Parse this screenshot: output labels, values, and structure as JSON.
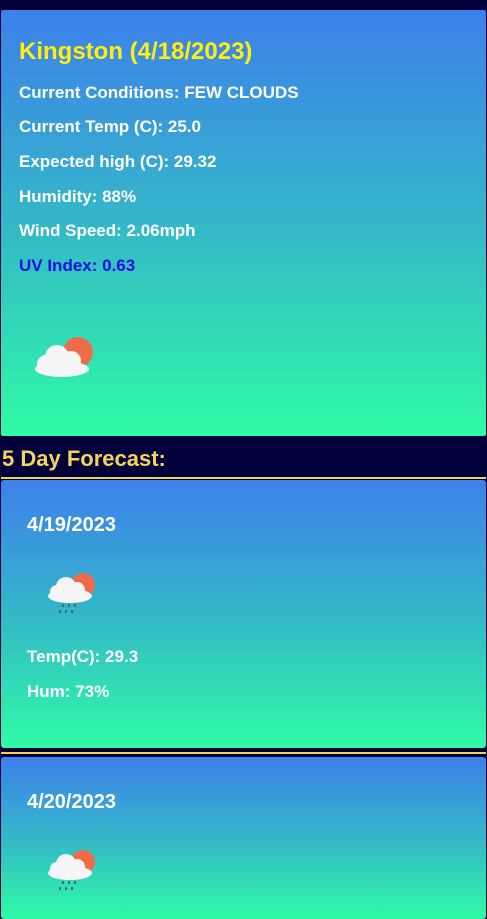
{
  "current": {
    "title": "Kingston (4/18/2023)",
    "conditions": "Current Conditions: FEW CLOUDS",
    "temp": "Current Temp (C): 25.0",
    "high": "Expected high (C): 29.32",
    "humidity": "Humidity: 88%",
    "wind": "Wind Speed: 2.06mph",
    "uv": "UV Index: 0.63",
    "icon": "few-clouds-icon"
  },
  "forecast": {
    "heading": "5 Day Forecast:",
    "days": [
      {
        "date": "4/19/2023",
        "icon": "rain-cloud-sun-icon",
        "temp": "Temp(C): 29.3",
        "hum": "Hum: 73%"
      },
      {
        "date": "4/20/2023",
        "icon": "rain-cloud-sun-icon"
      }
    ]
  },
  "colors": {
    "title_yellow": "#ffee12",
    "heading_gold": "#f4d35e",
    "uv_blue": "#1a0fe0",
    "background_navy": "#02003a"
  }
}
